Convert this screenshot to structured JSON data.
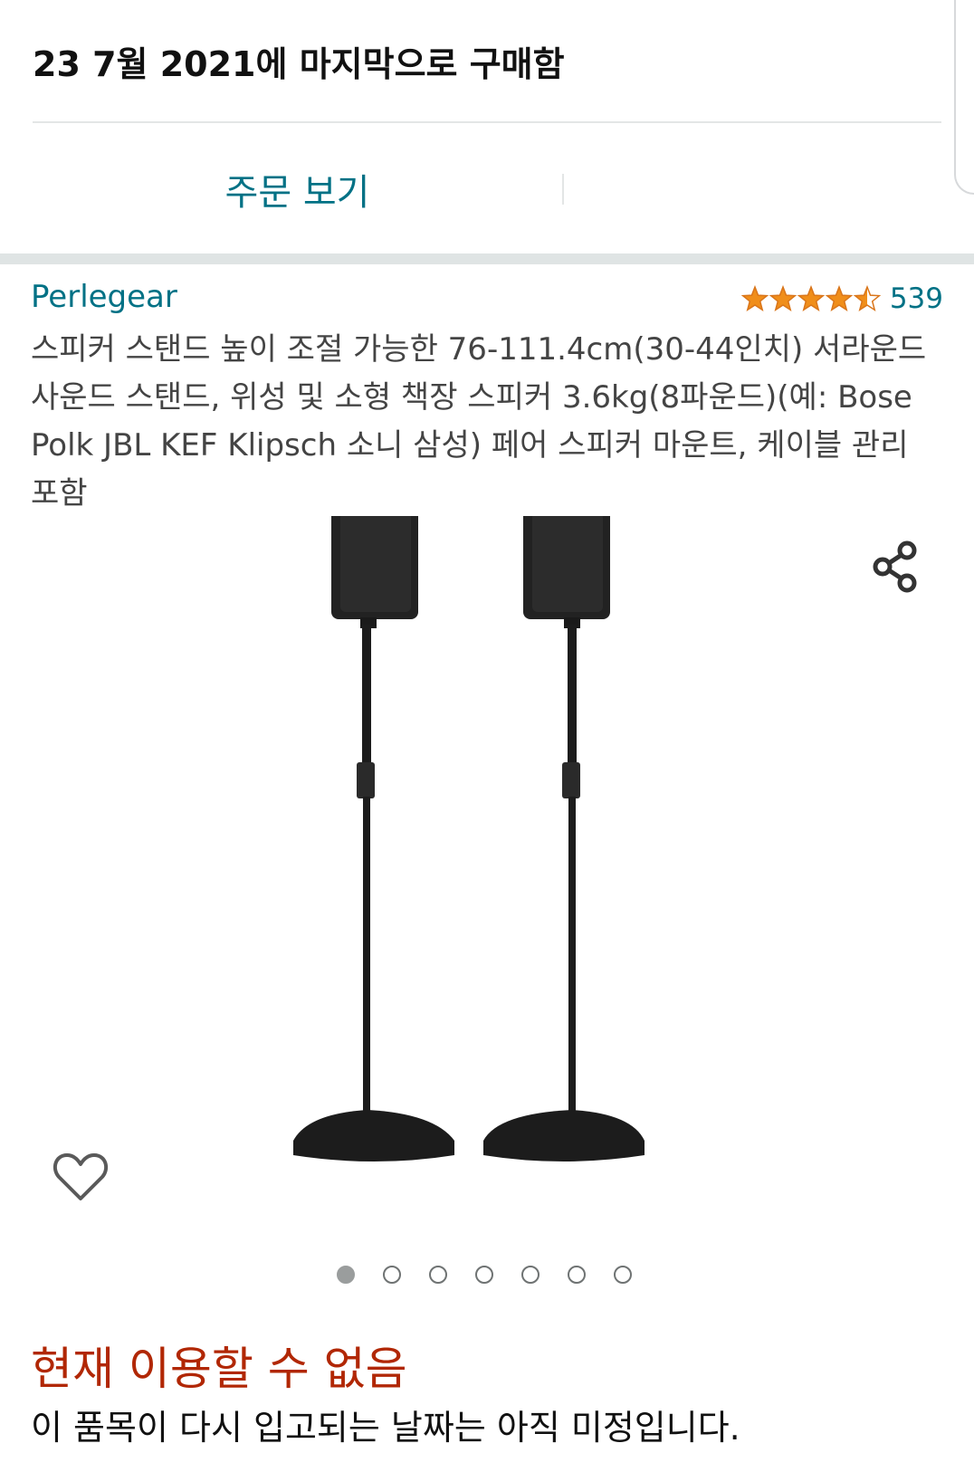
{
  "purchase_note": "23 7월 2021에 마지막으로 구매함",
  "view_order_label": "주문 보기",
  "product": {
    "brand": "Perlegear",
    "rating_stars": 4.5,
    "rating_count": "539",
    "title": "스피커 스탠드 높이 조절 가능한 76-111.4cm(30-44인치) 서라운드 사운드 스탠드, 위성 및 소형 책장 스피커 3.6kg(8파운드)(예: Bose Polk JBL KEF Klipsch 소니 삼성) 페어 스피커 마운트, 케이블 관리 포함"
  },
  "carousel": {
    "total_images": 7,
    "active_index": 0
  },
  "icons": {
    "share": "share-icon",
    "wishlist": "heart-icon",
    "rating": "star-icon"
  },
  "colors": {
    "link": "#007185",
    "unavailable": "#b12704",
    "star": "#f08e1a",
    "divider": "#e3e6e6"
  },
  "availability": {
    "status": "현재 이용할 수 없음",
    "note": "이 품목이 다시 입고되는 날짜는 아직 미정입니다."
  }
}
